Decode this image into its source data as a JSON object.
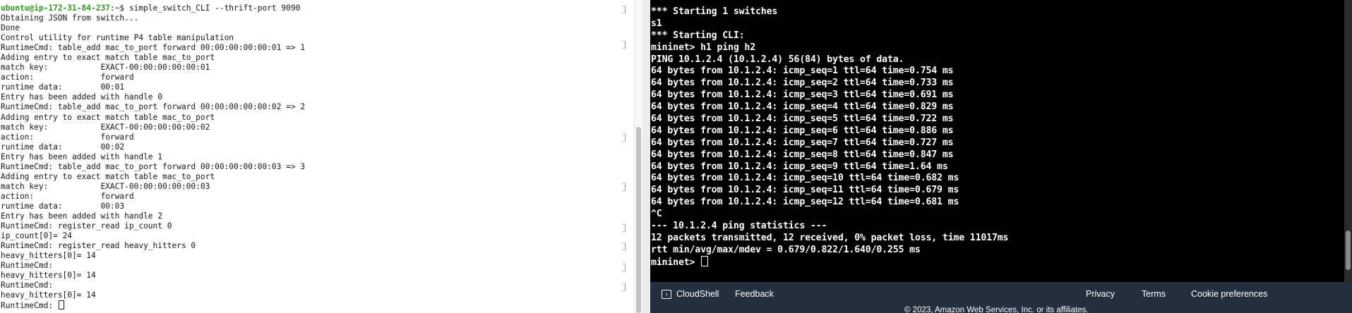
{
  "left_terminal": {
    "prompt_user": "ubuntu@ip-172-31-84-237",
    "prompt_rest": ":~$ simple_switch_CLI --thrift-port 9090",
    "lines": [
      "Obtaining JSON from switch...",
      "Done",
      "Control utility for runtime P4 table manipulation",
      "RuntimeCmd: table_add mac_to_port forward 00:00:00:00:00:01 => 1",
      "Adding entry to exact match table mac_to_port",
      "match key:           EXACT-00:00:00:00:00:01",
      "action:              forward",
      "runtime data:        00:01",
      "Entry has been added with handle 0",
      "RuntimeCmd: table_add mac_to_port forward 00:00:00:00:00:02 => 2",
      "Adding entry to exact match table mac_to_port",
      "match key:           EXACT-00:00:00:00:00:02",
      "action:              forward",
      "runtime data:        00:02",
      "Entry has been added with handle 1",
      "RuntimeCmd: table_add mac_to_port forward 00:00:00:00:00:03 => 3",
      "Adding entry to exact match table mac_to_port",
      "match key:           EXACT-00:00:00:00:00:03",
      "action:              forward",
      "runtime data:        00:03",
      "Entry has been added with handle 2",
      "RuntimeCmd: register_read ip_count 0",
      "ip_count[0]= 24",
      "RuntimeCmd: register_read heavy_hitters 0",
      "heavy_hitters[0]= 14",
      "RuntimeCmd:",
      "heavy_hitters[0]= 14",
      "RuntimeCmd:",
      "heavy_hitters[0]= 14"
    ],
    "last_prompt": "RuntimeCmd: "
  },
  "right_terminal": {
    "lines": [
      "*** Starting 1 switches",
      "s1",
      "*** Starting CLI:",
      "mininet> h1 ping h2",
      "PING 10.1.2.4 (10.1.2.4) 56(84) bytes of data.",
      "64 bytes from 10.1.2.4: icmp_seq=1 ttl=64 time=0.754 ms",
      "64 bytes from 10.1.2.4: icmp_seq=2 ttl=64 time=0.733 ms",
      "64 bytes from 10.1.2.4: icmp_seq=3 ttl=64 time=0.691 ms",
      "64 bytes from 10.1.2.4: icmp_seq=4 ttl=64 time=0.829 ms",
      "64 bytes from 10.1.2.4: icmp_seq=5 ttl=64 time=0.722 ms",
      "64 bytes from 10.1.2.4: icmp_seq=6 ttl=64 time=0.886 ms",
      "64 bytes from 10.1.2.4: icmp_seq=7 ttl=64 time=0.727 ms",
      "64 bytes from 10.1.2.4: icmp_seq=8 ttl=64 time=0.847 ms",
      "64 bytes from 10.1.2.4: icmp_seq=9 ttl=64 time=1.64 ms",
      "64 bytes from 10.1.2.4: icmp_seq=10 ttl=64 time=0.682 ms",
      "64 bytes from 10.1.2.4: icmp_seq=11 ttl=64 time=0.679 ms",
      "64 bytes from 10.1.2.4: icmp_seq=12 ttl=64 time=0.681 ms",
      "^C",
      "--- 10.1.2.4 ping statistics ---",
      "12 packets transmitted, 12 received, 0% packet loss, time 11017ms",
      "rtt min/avg/max/mdev = 0.679/0.822/1.640/0.255 ms"
    ],
    "last_prompt": "mininet> "
  },
  "footer": {
    "cloudshell": "CloudShell",
    "feedback": "Feedback",
    "privacy": "Privacy",
    "terms": "Terms",
    "cookie": "Cookie preferences",
    "copyright": "© 2023, Amazon Web Services, Inc. or its affiliates."
  },
  "colors": {
    "prompt_user": "#2e9a1e",
    "right_background": "#000000",
    "footer_background": "#232f3e"
  },
  "icons": {
    "cloudshell": "terminal-icon"
  }
}
